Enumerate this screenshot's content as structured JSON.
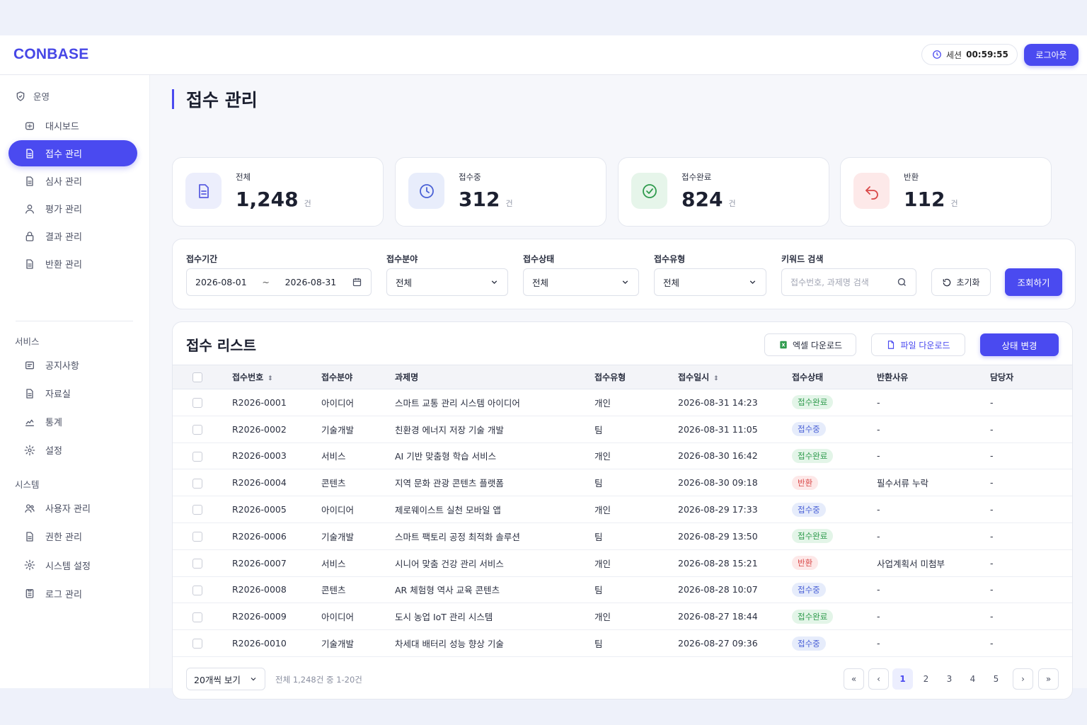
{
  "app": {
    "brand": "CONBASE",
    "accent": "#4a4af0"
  },
  "header": {
    "session_label": "세션",
    "session_time": "00:59:55",
    "logout_label": "로그아웃"
  },
  "sidebar": {
    "sections": [
      {
        "label": "운영",
        "icon": "shield-icon"
      },
      {
        "label": "서비스"
      },
      {
        "label": "시스템"
      }
    ],
    "ops_items": [
      {
        "label": "대시보드",
        "icon": "dashboard-icon"
      },
      {
        "label": "접수 관리",
        "icon": "document-icon",
        "active": true
      },
      {
        "label": "심사 관리",
        "icon": "document-icon"
      },
      {
        "label": "평가 관리",
        "icon": "user-icon"
      },
      {
        "label": "결과 관리",
        "icon": "lock-icon"
      },
      {
        "label": "반환 관리",
        "icon": "document-icon"
      }
    ],
    "service_items": [
      {
        "label": "공지사항",
        "icon": "notice-icon"
      },
      {
        "label": "자료실",
        "icon": "document-icon"
      },
      {
        "label": "통계",
        "icon": "chart-icon"
      },
      {
        "label": "설정",
        "icon": "gear-icon"
      }
    ],
    "system_items": [
      {
        "label": "사용자 관리",
        "icon": "users-icon"
      },
      {
        "label": "권한 관리",
        "icon": "document-icon"
      },
      {
        "label": "시스템 설정",
        "icon": "gear-icon"
      },
      {
        "label": "로그 관리",
        "icon": "clipboard-icon"
      }
    ]
  },
  "page": {
    "title": "접수 관리"
  },
  "stats": [
    {
      "label": "전체",
      "value": "1,248",
      "unit": "건",
      "icon": "document-icon",
      "color": "#5b5fe0",
      "bg": "#eceefc"
    },
    {
      "label": "접수중",
      "value": "312",
      "unit": "건",
      "icon": "clock-icon",
      "color": "#4a61d6",
      "bg": "#e8edfb"
    },
    {
      "label": "접수완료",
      "value": "824",
      "unit": "건",
      "icon": "check-circle-icon",
      "color": "#2f9b4d",
      "bg": "#e6f5ea"
    },
    {
      "label": "반환",
      "value": "112",
      "unit": "건",
      "icon": "return-icon",
      "color": "#d94848",
      "bg": "#fde9e9"
    }
  ],
  "filters": {
    "period_label": "접수기간",
    "date_from": "2026-08-01",
    "date_sep": "~",
    "date_to": "2026-08-31",
    "field_label": "접수분야",
    "field_value": "전체",
    "status_label": "접수상태",
    "status_value": "전체",
    "type_label": "접수유형",
    "type_value": "전체",
    "keyword_label": "키워드 검색",
    "keyword_placeholder": "접수번호, 과제명 검색",
    "reset_label": "초기화",
    "search_label": "조회하기"
  },
  "list": {
    "title": "접수 리스트",
    "excel_label": "엑셀 다운로드",
    "file_label": "파일 다운로드",
    "status_change_label": "상태 변경",
    "columns": [
      "접수번호",
      "접수분야",
      "과제명",
      "접수유형",
      "접수일시",
      "접수상태",
      "반환사유",
      "담당자"
    ],
    "rows": [
      {
        "no": "R2026-0001",
        "field": "아이디어",
        "name": "스마트 교통 관리 시스템 아이디어",
        "type": "개인",
        "date": "2026-08-31 14:23",
        "status": "접수완료",
        "reason": "-",
        "owner": "-"
      },
      {
        "no": "R2026-0002",
        "field": "기술개발",
        "name": "친환경 에너지 저장 기술 개발",
        "type": "팀",
        "date": "2026-08-31 11:05",
        "status": "접수중",
        "reason": "-",
        "owner": "-"
      },
      {
        "no": "R2026-0003",
        "field": "서비스",
        "name": "AI 기반 맞춤형 학습 서비스",
        "type": "개인",
        "date": "2026-08-30 16:42",
        "status": "접수완료",
        "reason": "-",
        "owner": "-"
      },
      {
        "no": "R2026-0004",
        "field": "콘텐츠",
        "name": "지역 문화 관광 콘텐츠 플랫폼",
        "type": "팀",
        "date": "2026-08-30 09:18",
        "status": "반환",
        "reason": "필수서류 누락",
        "owner": "-"
      },
      {
        "no": "R2026-0005",
        "field": "아이디어",
        "name": "제로웨이스트 실천 모바일 앱",
        "type": "개인",
        "date": "2026-08-29 17:33",
        "status": "접수중",
        "reason": "-",
        "owner": "-"
      },
      {
        "no": "R2026-0006",
        "field": "기술개발",
        "name": "스마트 팩토리 공정 최적화 솔루션",
        "type": "팀",
        "date": "2026-08-29 13:50",
        "status": "접수완료",
        "reason": "-",
        "owner": "-"
      },
      {
        "no": "R2026-0007",
        "field": "서비스",
        "name": "시니어 맞춤 건강 관리 서비스",
        "type": "개인",
        "date": "2026-08-28 15:21",
        "status": "반환",
        "reason": "사업계획서 미첨부",
        "owner": "-"
      },
      {
        "no": "R2026-0008",
        "field": "콘텐츠",
        "name": "AR 체험형 역사 교육 콘텐츠",
        "type": "팀",
        "date": "2026-08-28 10:07",
        "status": "접수중",
        "reason": "-",
        "owner": "-"
      },
      {
        "no": "R2026-0009",
        "field": "아이디어",
        "name": "도시 농업 IoT 관리 시스템",
        "type": "개인",
        "date": "2026-08-27 18:44",
        "status": "접수완료",
        "reason": "-",
        "owner": "-"
      },
      {
        "no": "R2026-0010",
        "field": "기술개발",
        "name": "차세대 배터리 성능 향상 기술",
        "type": "팀",
        "date": "2026-08-27 09:36",
        "status": "접수중",
        "reason": "-",
        "owner": "-"
      }
    ]
  },
  "pagination": {
    "page_size_label": "20개씩 보기",
    "summary": "전체 1,248건 중 1-20건",
    "pages": [
      "1",
      "2",
      "3",
      "4",
      "5"
    ],
    "current": "1"
  }
}
